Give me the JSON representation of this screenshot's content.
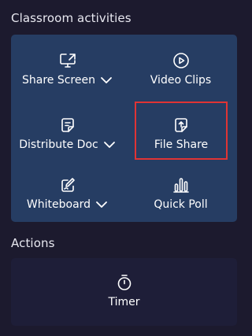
{
  "classroom": {
    "title": "Classroom activities",
    "items": [
      {
        "label": "Share Screen",
        "icon": "share-screen-icon",
        "has_dropdown": true
      },
      {
        "label": "Video Clips",
        "icon": "video-clips-icon",
        "has_dropdown": false
      },
      {
        "label": "Distribute Doc",
        "icon": "document-icon",
        "has_dropdown": true
      },
      {
        "label": "File Share",
        "icon": "file-upload-icon",
        "has_dropdown": false,
        "selected": true
      },
      {
        "label": "Whiteboard",
        "icon": "whiteboard-icon",
        "has_dropdown": true
      },
      {
        "label": "Quick Poll",
        "icon": "poll-icon",
        "has_dropdown": false
      }
    ]
  },
  "actions": {
    "title": "Actions",
    "items": [
      {
        "label": "Timer",
        "icon": "timer-icon"
      }
    ]
  },
  "colors": {
    "background": "#1c1a2e",
    "activities_panel": "#263d63",
    "actions_panel": "#1e1e38",
    "selection_outline": "#e03434"
  }
}
